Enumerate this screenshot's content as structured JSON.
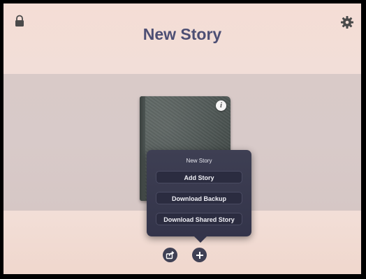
{
  "header": {
    "title": "New Story",
    "left_icon": "lock-icon",
    "right_icon": "gear-icon"
  },
  "book": {
    "info_label": "i"
  },
  "popover": {
    "title": "New Story",
    "buttons": [
      {
        "label": "Add Story"
      },
      {
        "label": "Download Backup"
      },
      {
        "label": "Download Shared Story"
      }
    ]
  },
  "bottom_bar": {
    "share_icon": "share-icon",
    "add_icon": "plus-icon"
  },
  "colors": {
    "title": "#4d4f74",
    "popover": "#3a3b50",
    "button_icon": "#3f4054"
  }
}
